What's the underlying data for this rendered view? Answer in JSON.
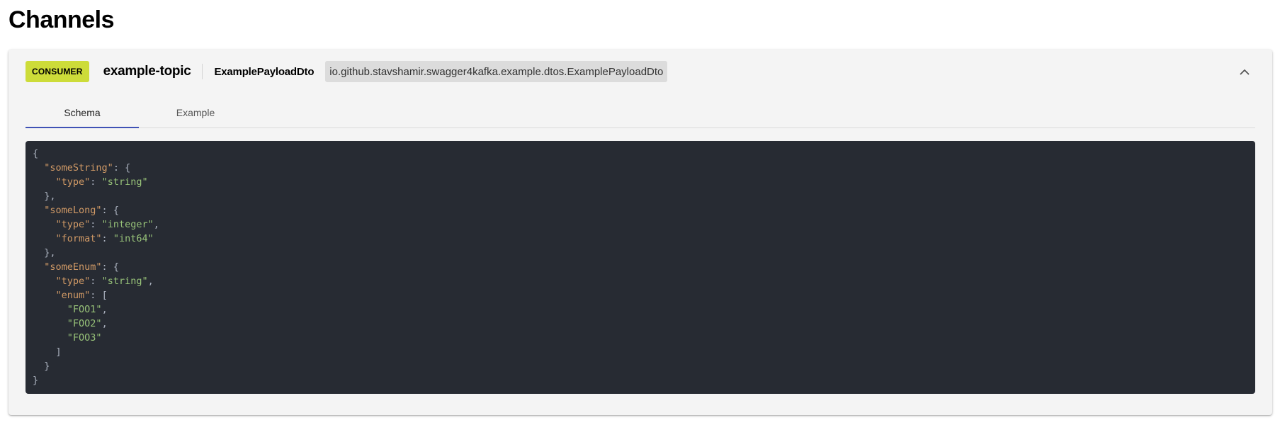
{
  "page": {
    "title": "Channels"
  },
  "channel": {
    "badge": "CONSUMER",
    "topic": "example-topic",
    "payload_name": "ExamplePayloadDto",
    "payload_class": "io.github.stavshamir.swagger4kafka.example.dtos.ExamplePayloadDto",
    "collapse_icon": "chevron-up-icon"
  },
  "tabs": [
    {
      "label": "Schema",
      "active": true
    },
    {
      "label": "Example",
      "active": false
    }
  ],
  "code": {
    "lines": [
      "{",
      "  \"someString\": {",
      "    \"type\": \"string\"",
      "  },",
      "  \"someLong\": {",
      "    \"type\": \"integer\",",
      "    \"format\": \"int64\"",
      "  },",
      "  \"someEnum\": {",
      "    \"type\": \"string\",",
      "    \"enum\": [",
      "      \"FOO1\",",
      "      \"FOO2\",",
      "      \"FOO3\"",
      "    ]",
      "  }",
      "}"
    ]
  },
  "colors": {
    "badge": "#cddc39",
    "tab_indicator": "#3f51b5",
    "code_background": "#272b33",
    "code_key": "#d19a66",
    "code_string": "#98c379"
  }
}
